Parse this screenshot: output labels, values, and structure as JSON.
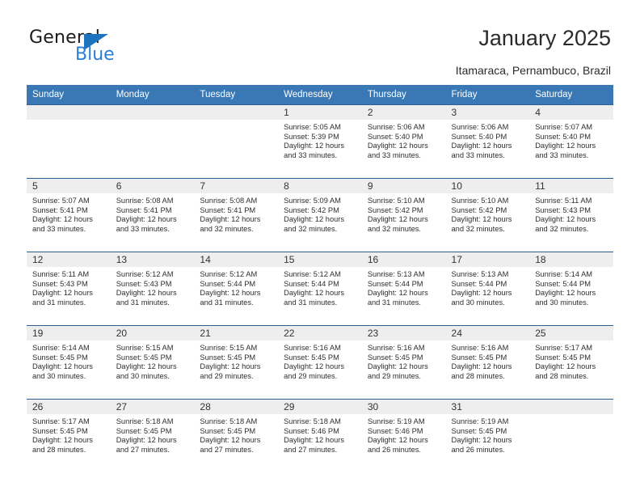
{
  "brand": {
    "name_top": "General",
    "name_bottom": "Blue",
    "accent_color": "#2a7fd4",
    "triangle_icon": "triangle-icon"
  },
  "header": {
    "title": "January 2025",
    "subtitle": "Itamaraca, Pernambuco, Brazil"
  },
  "calendar": {
    "header_bg": "#3a78b5",
    "daynum_bg": "#eeeeee",
    "row_rule_color": "#2c5f91",
    "weekday_headers": [
      "Sunday",
      "Monday",
      "Tuesday",
      "Wednesday",
      "Thursday",
      "Friday",
      "Saturday"
    ],
    "labels": {
      "sunrise": "Sunrise:",
      "sunset": "Sunset:",
      "daylight": "Daylight:"
    },
    "weeks": [
      [
        {
          "day": ""
        },
        {
          "day": ""
        },
        {
          "day": ""
        },
        {
          "day": "1",
          "sunrise": "Sunrise: 5:05 AM",
          "sunset": "Sunset: 5:39 PM",
          "daylight_1": "Daylight: 12 hours",
          "daylight_2": "and 33 minutes."
        },
        {
          "day": "2",
          "sunrise": "Sunrise: 5:06 AM",
          "sunset": "Sunset: 5:40 PM",
          "daylight_1": "Daylight: 12 hours",
          "daylight_2": "and 33 minutes."
        },
        {
          "day": "3",
          "sunrise": "Sunrise: 5:06 AM",
          "sunset": "Sunset: 5:40 PM",
          "daylight_1": "Daylight: 12 hours",
          "daylight_2": "and 33 minutes."
        },
        {
          "day": "4",
          "sunrise": "Sunrise: 5:07 AM",
          "sunset": "Sunset: 5:40 PM",
          "daylight_1": "Daylight: 12 hours",
          "daylight_2": "and 33 minutes."
        }
      ],
      [
        {
          "day": "5",
          "sunrise": "Sunrise: 5:07 AM",
          "sunset": "Sunset: 5:41 PM",
          "daylight_1": "Daylight: 12 hours",
          "daylight_2": "and 33 minutes."
        },
        {
          "day": "6",
          "sunrise": "Sunrise: 5:08 AM",
          "sunset": "Sunset: 5:41 PM",
          "daylight_1": "Daylight: 12 hours",
          "daylight_2": "and 33 minutes."
        },
        {
          "day": "7",
          "sunrise": "Sunrise: 5:08 AM",
          "sunset": "Sunset: 5:41 PM",
          "daylight_1": "Daylight: 12 hours",
          "daylight_2": "and 32 minutes."
        },
        {
          "day": "8",
          "sunrise": "Sunrise: 5:09 AM",
          "sunset": "Sunset: 5:42 PM",
          "daylight_1": "Daylight: 12 hours",
          "daylight_2": "and 32 minutes."
        },
        {
          "day": "9",
          "sunrise": "Sunrise: 5:10 AM",
          "sunset": "Sunset: 5:42 PM",
          "daylight_1": "Daylight: 12 hours",
          "daylight_2": "and 32 minutes."
        },
        {
          "day": "10",
          "sunrise": "Sunrise: 5:10 AM",
          "sunset": "Sunset: 5:42 PM",
          "daylight_1": "Daylight: 12 hours",
          "daylight_2": "and 32 minutes."
        },
        {
          "day": "11",
          "sunrise": "Sunrise: 5:11 AM",
          "sunset": "Sunset: 5:43 PM",
          "daylight_1": "Daylight: 12 hours",
          "daylight_2": "and 32 minutes."
        }
      ],
      [
        {
          "day": "12",
          "sunrise": "Sunrise: 5:11 AM",
          "sunset": "Sunset: 5:43 PM",
          "daylight_1": "Daylight: 12 hours",
          "daylight_2": "and 31 minutes."
        },
        {
          "day": "13",
          "sunrise": "Sunrise: 5:12 AM",
          "sunset": "Sunset: 5:43 PM",
          "daylight_1": "Daylight: 12 hours",
          "daylight_2": "and 31 minutes."
        },
        {
          "day": "14",
          "sunrise": "Sunrise: 5:12 AM",
          "sunset": "Sunset: 5:44 PM",
          "daylight_1": "Daylight: 12 hours",
          "daylight_2": "and 31 minutes."
        },
        {
          "day": "15",
          "sunrise": "Sunrise: 5:12 AM",
          "sunset": "Sunset: 5:44 PM",
          "daylight_1": "Daylight: 12 hours",
          "daylight_2": "and 31 minutes."
        },
        {
          "day": "16",
          "sunrise": "Sunrise: 5:13 AM",
          "sunset": "Sunset: 5:44 PM",
          "daylight_1": "Daylight: 12 hours",
          "daylight_2": "and 31 minutes."
        },
        {
          "day": "17",
          "sunrise": "Sunrise: 5:13 AM",
          "sunset": "Sunset: 5:44 PM",
          "daylight_1": "Daylight: 12 hours",
          "daylight_2": "and 30 minutes."
        },
        {
          "day": "18",
          "sunrise": "Sunrise: 5:14 AM",
          "sunset": "Sunset: 5:44 PM",
          "daylight_1": "Daylight: 12 hours",
          "daylight_2": "and 30 minutes."
        }
      ],
      [
        {
          "day": "19",
          "sunrise": "Sunrise: 5:14 AM",
          "sunset": "Sunset: 5:45 PM",
          "daylight_1": "Daylight: 12 hours",
          "daylight_2": "and 30 minutes."
        },
        {
          "day": "20",
          "sunrise": "Sunrise: 5:15 AM",
          "sunset": "Sunset: 5:45 PM",
          "daylight_1": "Daylight: 12 hours",
          "daylight_2": "and 30 minutes."
        },
        {
          "day": "21",
          "sunrise": "Sunrise: 5:15 AM",
          "sunset": "Sunset: 5:45 PM",
          "daylight_1": "Daylight: 12 hours",
          "daylight_2": "and 29 minutes."
        },
        {
          "day": "22",
          "sunrise": "Sunrise: 5:16 AM",
          "sunset": "Sunset: 5:45 PM",
          "daylight_1": "Daylight: 12 hours",
          "daylight_2": "and 29 minutes."
        },
        {
          "day": "23",
          "sunrise": "Sunrise: 5:16 AM",
          "sunset": "Sunset: 5:45 PM",
          "daylight_1": "Daylight: 12 hours",
          "daylight_2": "and 29 minutes."
        },
        {
          "day": "24",
          "sunrise": "Sunrise: 5:16 AM",
          "sunset": "Sunset: 5:45 PM",
          "daylight_1": "Daylight: 12 hours",
          "daylight_2": "and 28 minutes."
        },
        {
          "day": "25",
          "sunrise": "Sunrise: 5:17 AM",
          "sunset": "Sunset: 5:45 PM",
          "daylight_1": "Daylight: 12 hours",
          "daylight_2": "and 28 minutes."
        }
      ],
      [
        {
          "day": "26",
          "sunrise": "Sunrise: 5:17 AM",
          "sunset": "Sunset: 5:45 PM",
          "daylight_1": "Daylight: 12 hours",
          "daylight_2": "and 28 minutes."
        },
        {
          "day": "27",
          "sunrise": "Sunrise: 5:18 AM",
          "sunset": "Sunset: 5:45 PM",
          "daylight_1": "Daylight: 12 hours",
          "daylight_2": "and 27 minutes."
        },
        {
          "day": "28",
          "sunrise": "Sunrise: 5:18 AM",
          "sunset": "Sunset: 5:45 PM",
          "daylight_1": "Daylight: 12 hours",
          "daylight_2": "and 27 minutes."
        },
        {
          "day": "29",
          "sunrise": "Sunrise: 5:18 AM",
          "sunset": "Sunset: 5:46 PM",
          "daylight_1": "Daylight: 12 hours",
          "daylight_2": "and 27 minutes."
        },
        {
          "day": "30",
          "sunrise": "Sunrise: 5:19 AM",
          "sunset": "Sunset: 5:46 PM",
          "daylight_1": "Daylight: 12 hours",
          "daylight_2": "and 26 minutes."
        },
        {
          "day": "31",
          "sunrise": "Sunrise: 5:19 AM",
          "sunset": "Sunset: 5:45 PM",
          "daylight_1": "Daylight: 12 hours",
          "daylight_2": "and 26 minutes."
        },
        {
          "day": ""
        }
      ]
    ]
  }
}
